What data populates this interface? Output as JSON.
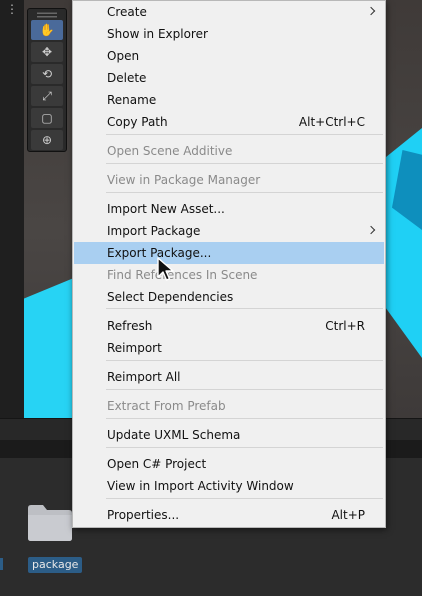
{
  "toolbar": {
    "menu_icon": "kebab-icon",
    "tools": [
      {
        "name": "hand-tool",
        "icon": "hand-icon",
        "glyph": "✋",
        "active": true
      },
      {
        "name": "move-tool",
        "icon": "move-icon",
        "glyph": "✥",
        "active": false
      },
      {
        "name": "rotate-tool",
        "icon": "rotate-icon",
        "glyph": "⟲",
        "active": false
      },
      {
        "name": "scale-tool",
        "icon": "scale-icon",
        "glyph": "⤢",
        "active": false
      },
      {
        "name": "rect-tool",
        "icon": "rect-icon",
        "glyph": "▢",
        "active": false
      },
      {
        "name": "transform-tool",
        "icon": "transform-icon",
        "glyph": "⊕",
        "active": false
      }
    ]
  },
  "context_menu": {
    "items": [
      {
        "label": "Create",
        "submenu": true
      },
      {
        "label": "Show in Explorer"
      },
      {
        "label": "Open"
      },
      {
        "label": "Delete"
      },
      {
        "label": "Rename"
      },
      {
        "label": "Copy Path",
        "shortcut": "Alt+Ctrl+C"
      },
      {
        "label": "Open Scene Additive",
        "disabled": true
      },
      {
        "label": "View in Package Manager",
        "disabled": true
      },
      {
        "label": "Import New Asset..."
      },
      {
        "label": "Import Package",
        "submenu": true
      },
      {
        "label": "Export Package...",
        "highlighted": true
      },
      {
        "label": "Find References In Scene",
        "disabled": true
      },
      {
        "label": "Select Dependencies"
      },
      {
        "label": "Refresh",
        "shortcut": "Ctrl+R"
      },
      {
        "label": "Reimport"
      },
      {
        "label": "Reimport All"
      },
      {
        "label": "Extract From Prefab",
        "disabled": true
      },
      {
        "label": "Update UXML Schema"
      },
      {
        "label": "Open C# Project"
      },
      {
        "label": "View in Import Activity Window"
      },
      {
        "label": "Properties...",
        "shortcut": "Alt+P"
      }
    ]
  },
  "project": {
    "folder_label": "package",
    "folder_icon": "folder-icon"
  },
  "colors": {
    "menu_bg": "#f0f0f0",
    "highlight": "#a9cff1",
    "disabled_text": "#8a8a8a",
    "scene_plane": "#27d3f4",
    "selection_label": "#2c5d87"
  },
  "cursor_icon": "arrow-cursor-icon"
}
